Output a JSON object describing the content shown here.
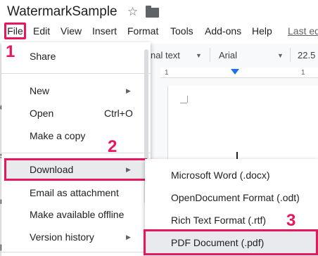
{
  "doc": {
    "title": "WatermarkSample",
    "star_icon": "star-icon",
    "folder_icon": "folder-icon"
  },
  "menubar": {
    "file": "File",
    "items": [
      "Edit",
      "View",
      "Insert",
      "Format",
      "Tools",
      "Add-ons",
      "Help"
    ],
    "last_edit": "Last ed"
  },
  "toolbar": {
    "style": "nal text",
    "font": "Arial",
    "size": "22.5"
  },
  "ruler": {
    "num1": "1",
    "num2": "1"
  },
  "file_menu": {
    "share": "Share",
    "new": "New",
    "open": "Open",
    "open_shortcut": "Ctrl+O",
    "make_copy": "Make a copy",
    "download": "Download",
    "email": "Email as attachment",
    "offline": "Make available offline",
    "version_history": "Version history"
  },
  "download_menu": {
    "docx": "Microsoft Word (.docx)",
    "odt": "OpenDocument Format (.odt)",
    "rtf": "Rich Text Format (.rtf)",
    "pdf": "PDF Document (.pdf)"
  },
  "steps": {
    "one": "1",
    "two": "2",
    "three": "3"
  },
  "colors": {
    "highlight": "#e8175d",
    "accent": "#1a73e8"
  }
}
